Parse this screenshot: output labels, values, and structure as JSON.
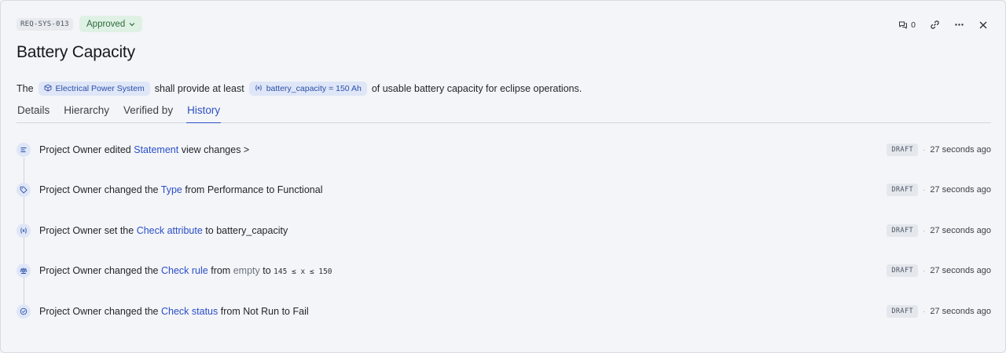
{
  "header": {
    "req_id": "REQ-SYS-013",
    "status": "Approved",
    "comment_count": "0",
    "title": "Battery Capacity"
  },
  "statement": {
    "prefix": "The",
    "system_chip": "Electrical Power System",
    "middle": "shall provide at least",
    "param_chip": "battery_capacity = 150 Ah",
    "suffix": "of usable battery capacity for eclipse operations."
  },
  "tabs": [
    {
      "label": "Details",
      "active": false
    },
    {
      "label": "Hierarchy",
      "active": false
    },
    {
      "label": "Verified by",
      "active": false
    },
    {
      "label": "History",
      "active": true
    }
  ],
  "history": [
    {
      "icon": "lines-icon",
      "actor": "Project Owner",
      "verb": "edited",
      "field": "Statement",
      "extra": "view changes >",
      "badge": "DRAFT",
      "time": "27 seconds ago"
    },
    {
      "icon": "tag-icon",
      "actor": "Project Owner",
      "verb": "changed the",
      "field": "Type",
      "from_word": "from",
      "from": "Performance",
      "to_word": "to",
      "to": "Functional",
      "badge": "DRAFT",
      "time": "27 seconds ago"
    },
    {
      "icon": "variable-icon",
      "actor": "Project Owner",
      "verb": "set the",
      "field": "Check attribute",
      "to_word": "to",
      "to": "battery_capacity",
      "badge": "DRAFT",
      "time": "27 seconds ago"
    },
    {
      "icon": "scale-icon",
      "actor": "Project Owner",
      "verb": "changed the",
      "field": "Check rule",
      "from_word": "from",
      "from": "empty",
      "to_word": "to",
      "to": "145 ≤ x ≤ 150",
      "badge": "DRAFT",
      "time": "27 seconds ago"
    },
    {
      "icon": "check-circle-icon",
      "actor": "Project Owner",
      "verb": "changed the",
      "field": "Check status",
      "from_word": "from",
      "from": "Not Run",
      "to_word": "to",
      "to": "Fail",
      "badge": "DRAFT",
      "time": "27 seconds ago"
    }
  ],
  "colors": {
    "accent": "#2a4fc8",
    "approved_bg": "#dff1e4",
    "approved_text": "#2e6b3d",
    "chip_bg": "#dfe6f7"
  }
}
